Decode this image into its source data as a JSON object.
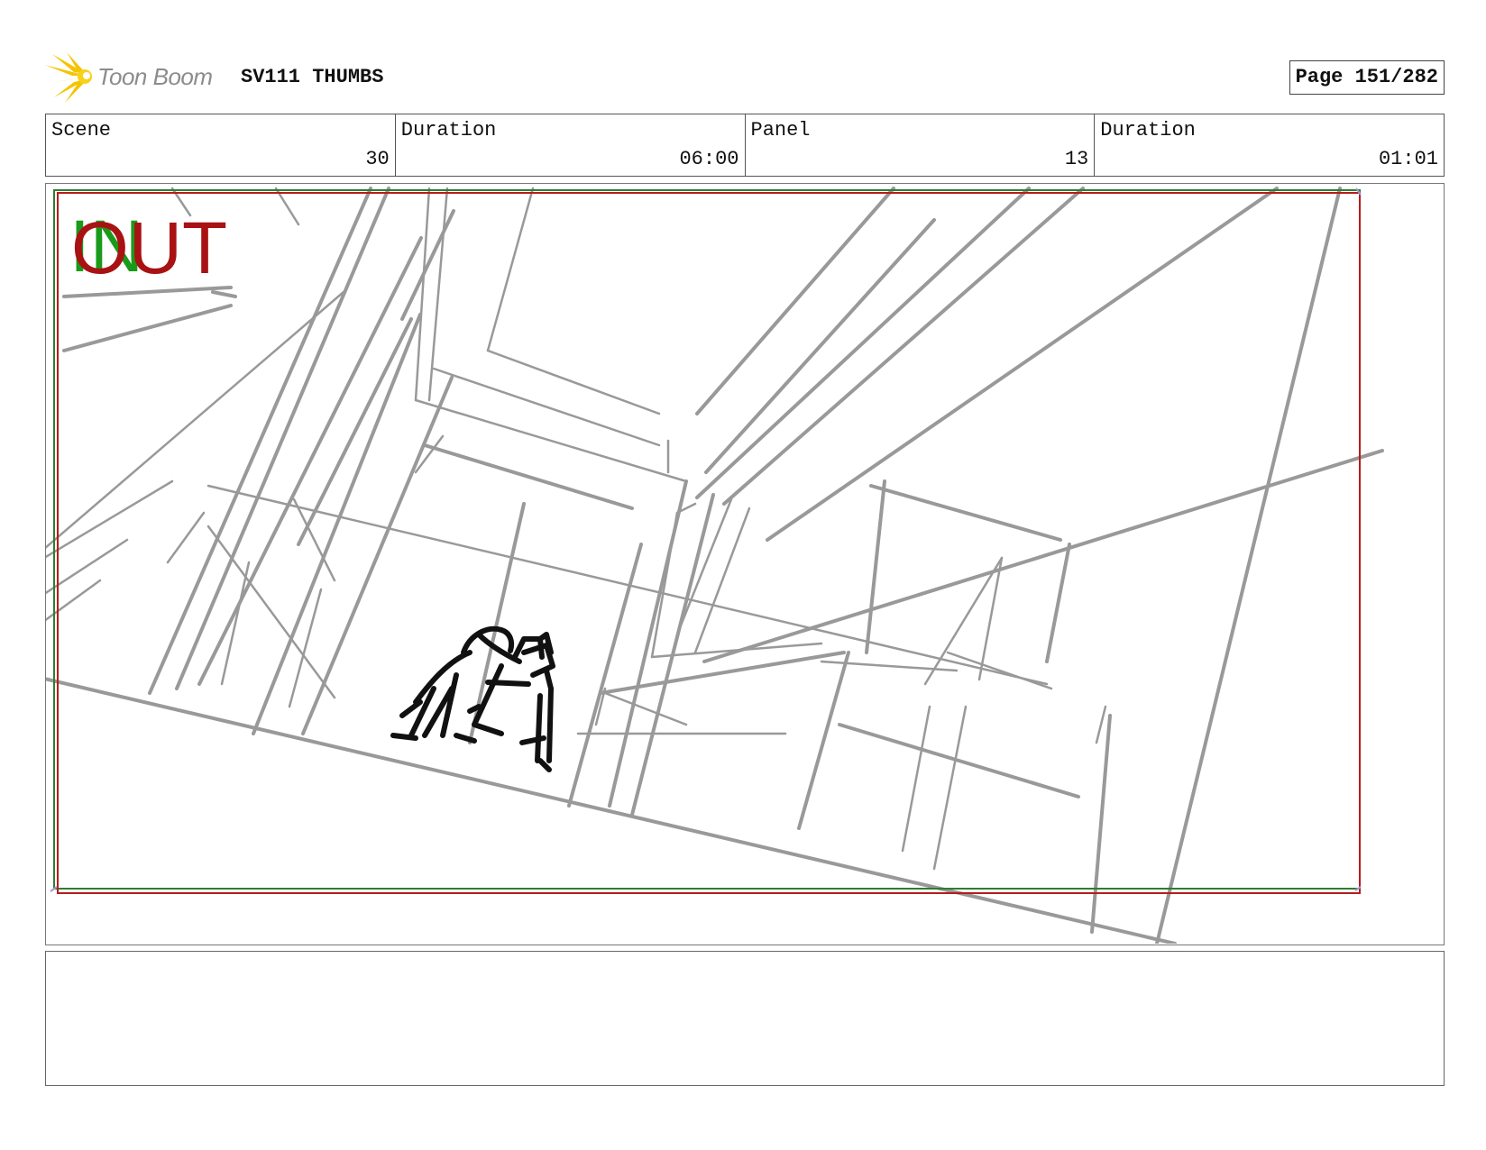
{
  "header": {
    "logo_text": "Toon Boom",
    "project_title": "SV111 THUMBS",
    "page_indicator": "Page 151/282"
  },
  "info": {
    "scene_label": "Scene",
    "scene_value": "30",
    "scene_duration_label": "Duration",
    "scene_duration_value": "06:00",
    "panel_label": "Panel",
    "panel_value": "13",
    "panel_duration_label": "Duration",
    "panel_duration_value": "01:01"
  },
  "panel": {
    "in_label": "IN",
    "out_label": "OUT",
    "sketch_color": "#999999",
    "figure_color": "#111111",
    "safe_frame_green": "#2e7d32",
    "safe_frame_red": "#b71c1c"
  },
  "notes": {
    "text": ""
  }
}
